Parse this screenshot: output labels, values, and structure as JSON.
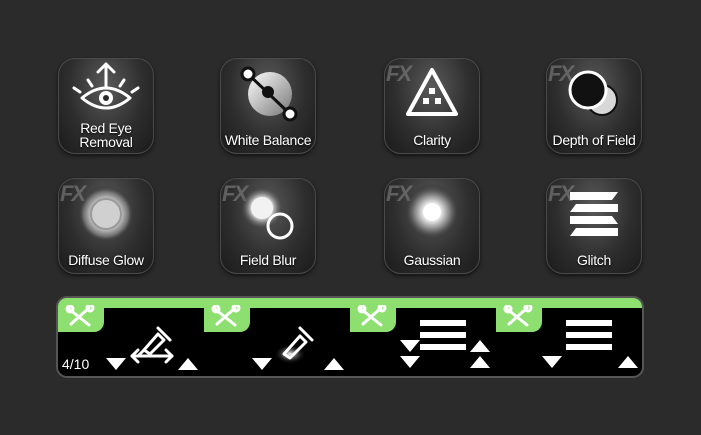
{
  "tiles": [
    {
      "label_line1": "Red Eye",
      "label_line2": "Removal",
      "icon": "eye-icon",
      "fx": ""
    },
    {
      "label": "White Balance",
      "icon": "white-balance-icon",
      "fx": ""
    },
    {
      "label": "Clarity",
      "icon": "clarity-triangle-icon",
      "fx": "FX"
    },
    {
      "label": "Depth of Field",
      "icon": "depth-of-field-icon",
      "fx": "FX"
    },
    {
      "label": "Diffuse Glow",
      "icon": "diffuse-glow-icon",
      "fx": "FX"
    },
    {
      "label": "Field Blur",
      "icon": "field-blur-icon",
      "fx": "FX"
    },
    {
      "label": "Gaussian",
      "icon": "gaussian-blur-icon",
      "fx": "FX"
    },
    {
      "label": "Glitch",
      "icon": "glitch-icon",
      "fx": "FX"
    }
  ],
  "panel": {
    "counter": "4/10",
    "accent": "#8de06f",
    "slots": [
      {
        "icon": "eyedropper-arrows-icon"
      },
      {
        "icon": "eyedropper-glow-icon"
      },
      {
        "icon": "stack-arrows-icon"
      },
      {
        "icon": "stack-lines-icon"
      }
    ]
  }
}
